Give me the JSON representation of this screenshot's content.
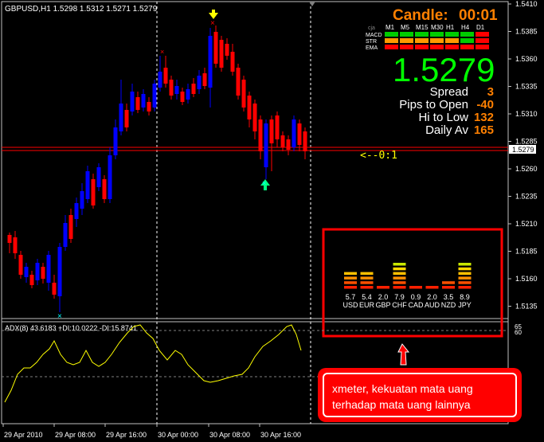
{
  "chart": {
    "symbol_header": "GBPUSD,H1  1.5298 1.5312 1.5271 1.5279",
    "price_labels": [
      "1.5410",
      "1.5385",
      "1.5360",
      "1.5335",
      "1.5310",
      "1.5285",
      "1.5260",
      "1.5235",
      "1.5210",
      "1.5185",
      "1.5160",
      "1.5135"
    ],
    "current_price_tag": "1.5279",
    "time_labels": [
      "29 Apr 2010",
      "29 Apr 08:00",
      "29 Apr 16:00",
      "30 Apr 00:00",
      "30 Apr 08:00",
      "30 Apr 16:00"
    ],
    "arrow_text": "<--0:1",
    "colors": {
      "bull": "#0000ff",
      "bear": "#ff0000",
      "level_line": "#ff0000",
      "adx_line": "#ffff00",
      "accent_text": "#ff8000",
      "green_text": "#00ff00"
    }
  },
  "candle_panel": {
    "label": "Candle:",
    "timer": "00:01",
    "header_label": "cja",
    "timeframes": [
      "M1",
      "M5",
      "M15",
      "M30",
      "H1",
      "H4",
      "D1"
    ],
    "rows": [
      {
        "name": "MACD",
        "cells": [
          "green",
          "green",
          "green",
          "green",
          "green",
          "green",
          "red"
        ]
      },
      {
        "name": "STR",
        "cells": [
          "orange",
          "orange",
          "orange",
          "orange",
          "orange",
          "green",
          "red"
        ]
      },
      {
        "name": "EMA",
        "cells": [
          "red",
          "red",
          "red",
          "red",
          "red",
          "red",
          "red"
        ]
      }
    ],
    "big_price": "1.5279",
    "stats": [
      {
        "label": "Spread",
        "value": "3"
      },
      {
        "label": "Pips to Open",
        "value": "-40"
      },
      {
        "label": "Hi to Low",
        "value": "132"
      },
      {
        "label": "Daily Av",
        "value": "165"
      }
    ]
  },
  "xmeter": {
    "currencies": [
      "USD",
      "EUR",
      "GBP",
      "CHF",
      "CAD",
      "AUD",
      "NZD",
      "JPY"
    ],
    "values": [
      5.7,
      5.4,
      2.0,
      7.9,
      0.9,
      2.0,
      3.5,
      8.9
    ],
    "value_labels": [
      "5.7",
      "5.4",
      "2.0",
      "7.9",
      "0.9",
      "2.0",
      "3.5",
      "8.9"
    ],
    "highlight_color": "#ff0000"
  },
  "adx": {
    "label": "ADX(8) 43.6183 +DI:10.0222 -DI:15.8741",
    "scale_labels": [
      "65",
      "60"
    ]
  },
  "callout": {
    "line1": "xmeter, kekuatan mata uang",
    "line2": "terhadap mata uang lainnya"
  }
}
